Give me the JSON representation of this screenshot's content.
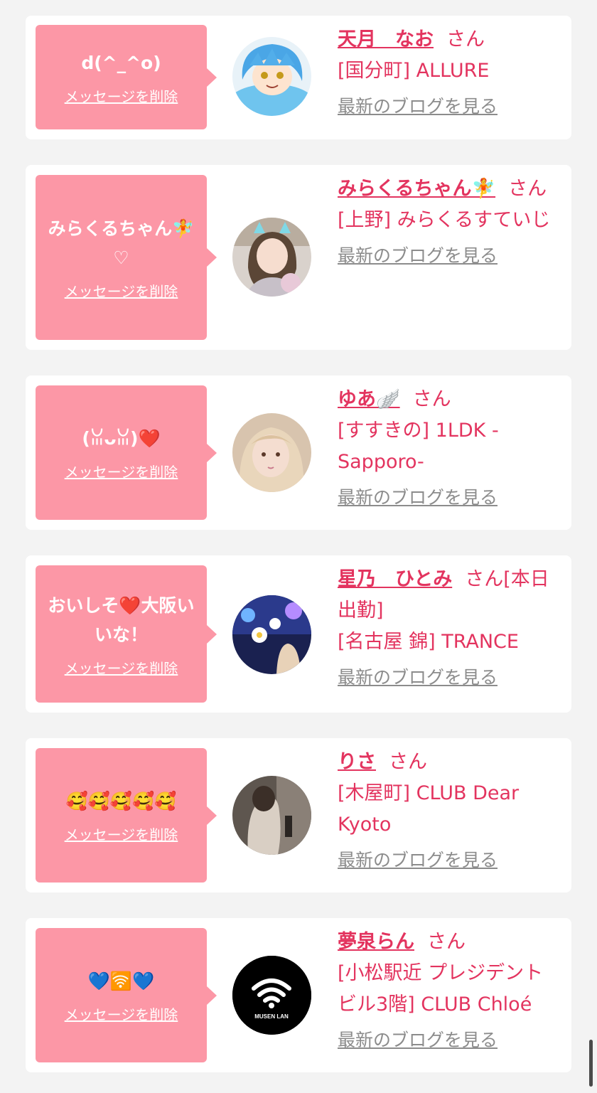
{
  "favorites": [
    {
      "message": "d(^_^o)",
      "delete_label": "メッセージを削除",
      "name": "天月　なお",
      "honorific": "さん",
      "shop": "[国分町] ALLURE",
      "blog_label": "最新のブログを見る"
    },
    {
      "message": "みらくるちゃん🧚♡",
      "delete_label": "メッセージを削除",
      "name": "みらくるちゃん🧚",
      "honorific": "さん",
      "shop": "[上野] みらくるすていじ",
      "blog_label": "最新のブログを見る"
    },
    {
      "message": "(ꈍᴗꈍ)❤️",
      "delete_label": "メッセージを削除",
      "name": "ゆあ🪽",
      "honorific": "さん",
      "shop": "[すすきの] 1LDK -Sapporo-",
      "blog_label": "最新のブログを見る"
    },
    {
      "message": "おいしそ❤️大阪いいな！",
      "delete_label": "メッセージを削除",
      "name": "星乃　ひとみ",
      "honorific": "さん[本日出勤]",
      "shop": "[名古屋 錦] TRANCE",
      "blog_label": "最新のブログを見る"
    },
    {
      "message": "🥰🥰🥰🥰🥰",
      "delete_label": "メッセージを削除",
      "name": "りさ",
      "honorific": "さん",
      "shop": "[木屋町] CLUB Dear Kyoto",
      "blog_label": "最新のブログを見る"
    },
    {
      "message": "💙🛜💙",
      "delete_label": "メッセージを削除",
      "name": "夢泉らん",
      "honorific": "さん",
      "shop": "[小松駅近 プレジデントビル3階] CLUB Chloé",
      "blog_label": "最新のブログを見る"
    }
  ],
  "avatar_logo_text": "MUSEN LAN",
  "colors": {
    "page_bg": "#f3f3f3",
    "card_bg": "#ffffff",
    "bubble_bg": "#fc97a6",
    "accent": "#e3345f",
    "link_gray": "#8c8c8c"
  }
}
